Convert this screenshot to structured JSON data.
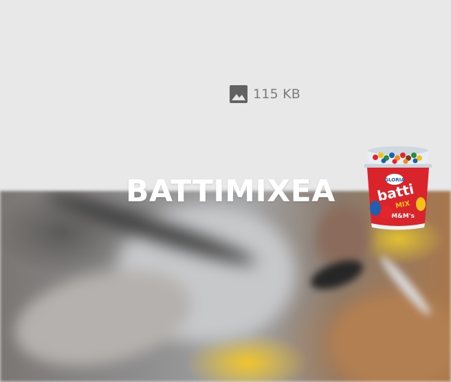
{
  "media_placeholder": {
    "icon": "image-icon",
    "file_size": "115 KB"
  },
  "promo": {
    "title": "BATTIMIXEA",
    "product_image": {
      "icon": "yogurt-cup-icon",
      "label_top": "GLORIA",
      "label_main": "batti",
      "label_mix": "MIX",
      "label_candy": "M&M's"
    }
  },
  "colors": {
    "placeholder_bg": "#e8e8e8",
    "meta_text": "#7b7b7b",
    "title_text": "#ffffff",
    "cup_red": "#d9242b"
  }
}
